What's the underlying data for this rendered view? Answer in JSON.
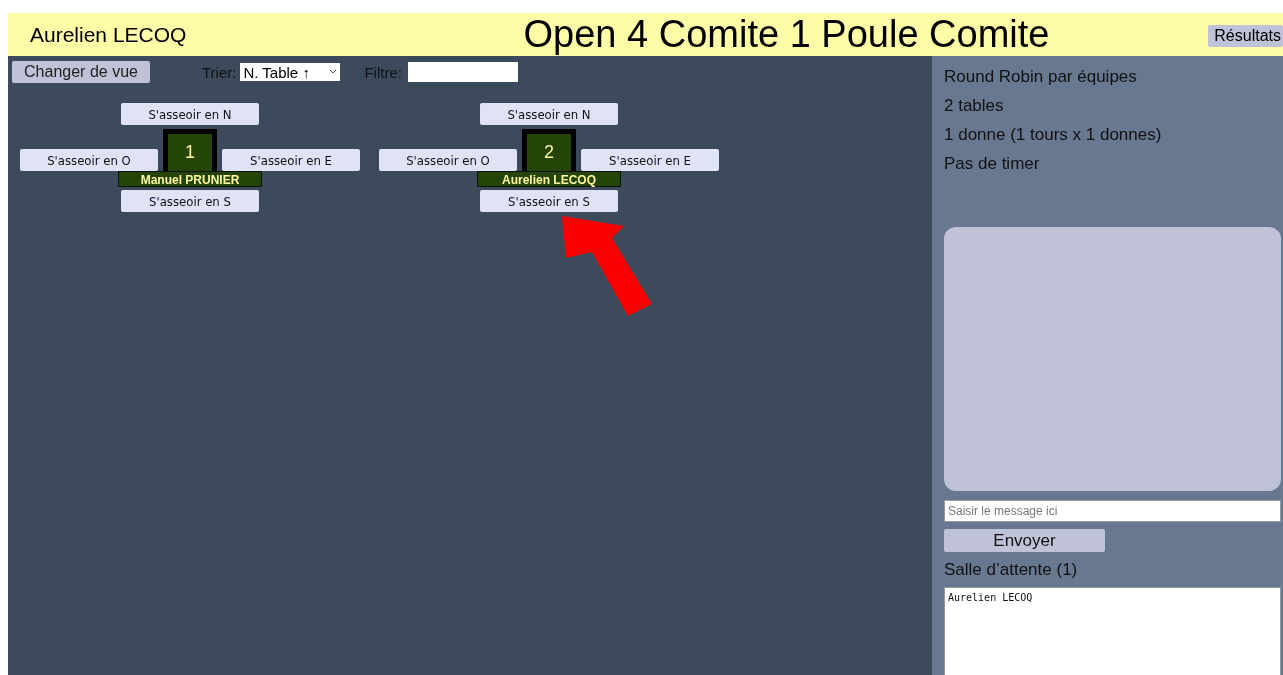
{
  "header": {
    "user": "Aurelien LECOQ",
    "title": "Open 4 Comite 1 Poule Comite",
    "results_button": "Résultats"
  },
  "toolbar": {
    "view_button": "Changer de vue",
    "sort_label": "Trier:",
    "sort_value": "N. Table ↑",
    "filter_label": "Filtre:"
  },
  "tables": [
    {
      "number": "1",
      "north": "S'asseoir en N",
      "west": "S'asseoir en O",
      "east": "S'asseoir en E",
      "south": "S'asseoir en S",
      "player": "Manuel PRUNIER"
    },
    {
      "number": "2",
      "north": "S'asseoir en N",
      "west": "S'asseoir en O",
      "east": "S'asseoir en E",
      "south": "S'asseoir en S",
      "player": "Aurelien LECOQ"
    }
  ],
  "info": [
    "Round Robin par équipes",
    "2 tables",
    "1 donne (1 tours x 1 donnes)",
    "Pas de timer"
  ],
  "chat": {
    "placeholder": "Saisir le message ici",
    "send_button": "Envoyer"
  },
  "waiting_room": {
    "title": "Salle d’attente (1)",
    "players": [
      "Aurelien LECOQ"
    ]
  }
}
